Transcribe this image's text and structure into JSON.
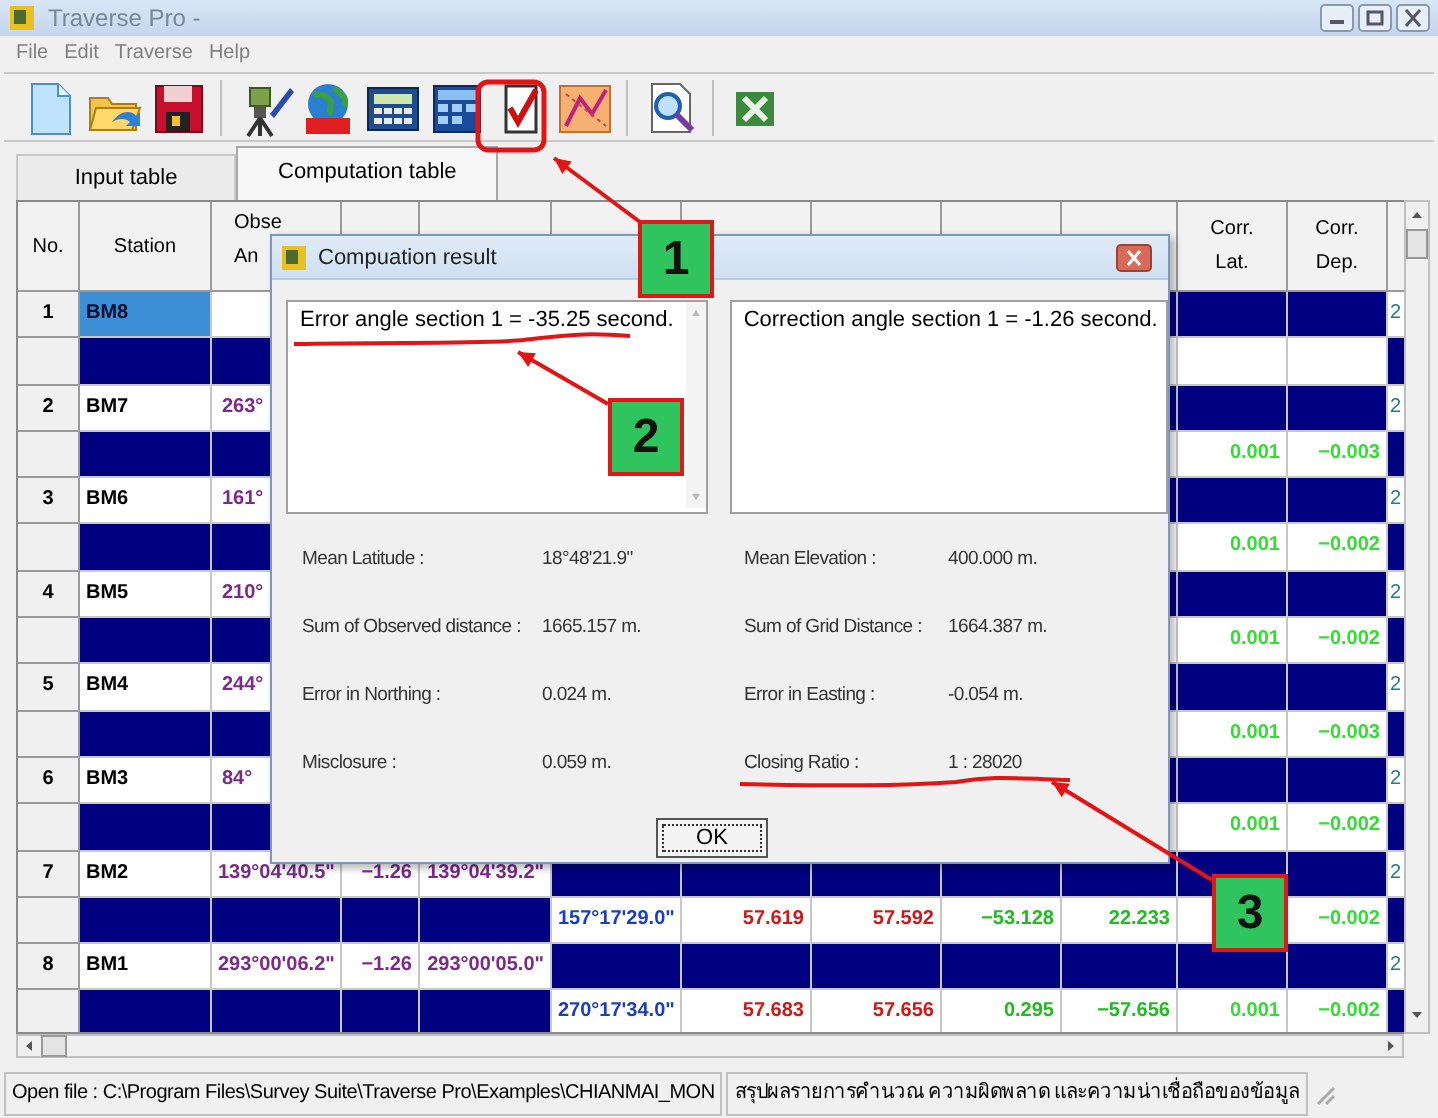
{
  "window": {
    "title": "Traverse Pro -"
  },
  "menu": [
    {
      "label": "File"
    },
    {
      "label": "Edit"
    },
    {
      "label": "Traverse"
    },
    {
      "label": "Help"
    }
  ],
  "toolbar": [
    {
      "kind": "new"
    },
    {
      "kind": "open"
    },
    {
      "kind": "save"
    },
    {
      "kind": "separator"
    },
    {
      "kind": "instrument"
    },
    {
      "kind": "utm"
    },
    {
      "kind": "calculator"
    },
    {
      "kind": "grid"
    },
    {
      "kind": "check"
    },
    {
      "kind": "chart"
    },
    {
      "kind": "separator"
    },
    {
      "kind": "preview"
    },
    {
      "kind": "separator"
    },
    {
      "kind": "sheet"
    }
  ],
  "tabs": [
    {
      "label": "Input table",
      "selected": false
    },
    {
      "label": "Computation table",
      "selected": true
    }
  ],
  "table": {
    "columns": [
      {
        "lines": [
          "No."
        ]
      },
      {
        "lines": [
          "Station"
        ]
      },
      {
        "lines": [
          "Obse",
          "An"
        ]
      },
      {},
      {},
      {},
      {},
      {},
      {},
      {},
      {
        "lines": [
          "Corr.",
          "Lat."
        ]
      },
      {
        "lines": [
          "Corr.",
          "Dep."
        ]
      },
      {}
    ],
    "rows": [
      {
        "kind": "station",
        "selected": true,
        "cells": [
          "1",
          "BM8",
          null,
          null,
          null,
          null,
          null,
          null,
          null,
          null,
          null,
          null,
          "2"
        ]
      },
      {
        "kind": "leg",
        "selected": false,
        "cells": [
          null,
          null,
          null,
          null,
          null,
          null,
          null,
          null,
          null,
          null,
          null,
          null,
          null
        ]
      },
      {
        "kind": "station",
        "selected": false,
        "cells": [
          "2",
          "BM7",
          "263°",
          null,
          null,
          null,
          null,
          null,
          null,
          null,
          null,
          null,
          "2"
        ]
      },
      {
        "kind": "leg",
        "selected": false,
        "cells": [
          null,
          null,
          null,
          null,
          null,
          null,
          null,
          null,
          null,
          null,
          "0.001",
          "−0.003",
          null
        ]
      },
      {
        "kind": "station",
        "selected": false,
        "cells": [
          "3",
          "BM6",
          "161°",
          null,
          null,
          null,
          null,
          null,
          null,
          null,
          null,
          null,
          "2"
        ]
      },
      {
        "kind": "leg",
        "selected": false,
        "cells": [
          null,
          null,
          null,
          null,
          null,
          null,
          null,
          null,
          null,
          null,
          "0.001",
          "−0.002",
          null
        ]
      },
      {
        "kind": "station",
        "selected": false,
        "cells": [
          "4",
          "BM5",
          "210°",
          null,
          null,
          null,
          null,
          null,
          null,
          null,
          null,
          null,
          "2"
        ]
      },
      {
        "kind": "leg",
        "selected": false,
        "cells": [
          null,
          null,
          null,
          null,
          null,
          null,
          null,
          null,
          null,
          null,
          "0.001",
          "−0.002",
          null
        ]
      },
      {
        "kind": "station",
        "selected": false,
        "cells": [
          "5",
          "BM4",
          "244°",
          null,
          null,
          null,
          null,
          null,
          null,
          null,
          null,
          null,
          "2"
        ]
      },
      {
        "kind": "leg",
        "selected": false,
        "cells": [
          null,
          null,
          null,
          null,
          null,
          null,
          null,
          null,
          null,
          null,
          "0.001",
          "−0.003",
          null
        ]
      },
      {
        "kind": "station",
        "selected": false,
        "cells": [
          "6",
          "BM3",
          "84°",
          null,
          null,
          null,
          null,
          null,
          null,
          null,
          null,
          null,
          "2"
        ]
      },
      {
        "kind": "leg",
        "selected": false,
        "cells": [
          null,
          null,
          null,
          null,
          null,
          null,
          null,
          null,
          null,
          null,
          "0.001",
          "−0.002",
          null
        ]
      },
      {
        "kind": "station",
        "selected": false,
        "cells": [
          "7",
          "BM2",
          "139°04'40.5\"",
          "−1.26",
          "139°04'39.2\"",
          null,
          null,
          null,
          null,
          null,
          null,
          null,
          "2"
        ]
      },
      {
        "kind": "leg",
        "selected": false,
        "cells": [
          null,
          null,
          null,
          null,
          null,
          "157°17'29.0\"",
          "57.619",
          "57.592",
          "−53.128",
          "22.233",
          null,
          "−0.002",
          null
        ]
      },
      {
        "kind": "station",
        "selected": false,
        "cells": [
          "8",
          "BM1",
          "293°00'06.2\"",
          "−1.26",
          "293°00'05.0\"",
          null,
          null,
          null,
          null,
          null,
          null,
          null,
          "2"
        ]
      },
      {
        "kind": "leg",
        "selected": false,
        "cells": [
          null,
          null,
          null,
          null,
          null,
          "270°17'34.0\"",
          "57.683",
          "57.656",
          "0.295",
          "−57.656",
          "0.001",
          "−0.002",
          null
        ]
      }
    ]
  },
  "dialog": {
    "title": "Compuation result",
    "messages": [
      "Error angle section  1 = -35.25  second.",
      "Correction angle section  1 = -1.26  second."
    ],
    "fields": [
      {
        "label": "Mean Latitude :",
        "value": "18°48'21.9\""
      },
      {
        "label": "Mean Elevation :",
        "value": "400.000 m."
      },
      {
        "label": "Sum of Observed distance :",
        "value": "1665.157 m."
      },
      {
        "label": "Sum of Grid Distance :",
        "value": "1664.387 m."
      },
      {
        "label": "Error in Northing :",
        "value": "0.024 m."
      },
      {
        "label": "Error in Easting :",
        "value": "-0.054 m."
      },
      {
        "label": "Misclosure :",
        "value": "0.059 m."
      },
      {
        "label": "Closing Ratio   :",
        "value": "1 : 28020"
      }
    ],
    "ok_button": "OK"
  },
  "status_bar": [
    "Open file : C:\\Program Files\\Survey Suite\\Traverse Pro\\Examples\\CHIANMAI_MON",
    "สรุปผลรายการคำนวณ ความผิดพลาด และความน่าเชื่อถือของข้อมูล"
  ],
  "annotations": [
    {
      "number": "1"
    },
    {
      "number": "2"
    },
    {
      "number": "3"
    }
  ]
}
